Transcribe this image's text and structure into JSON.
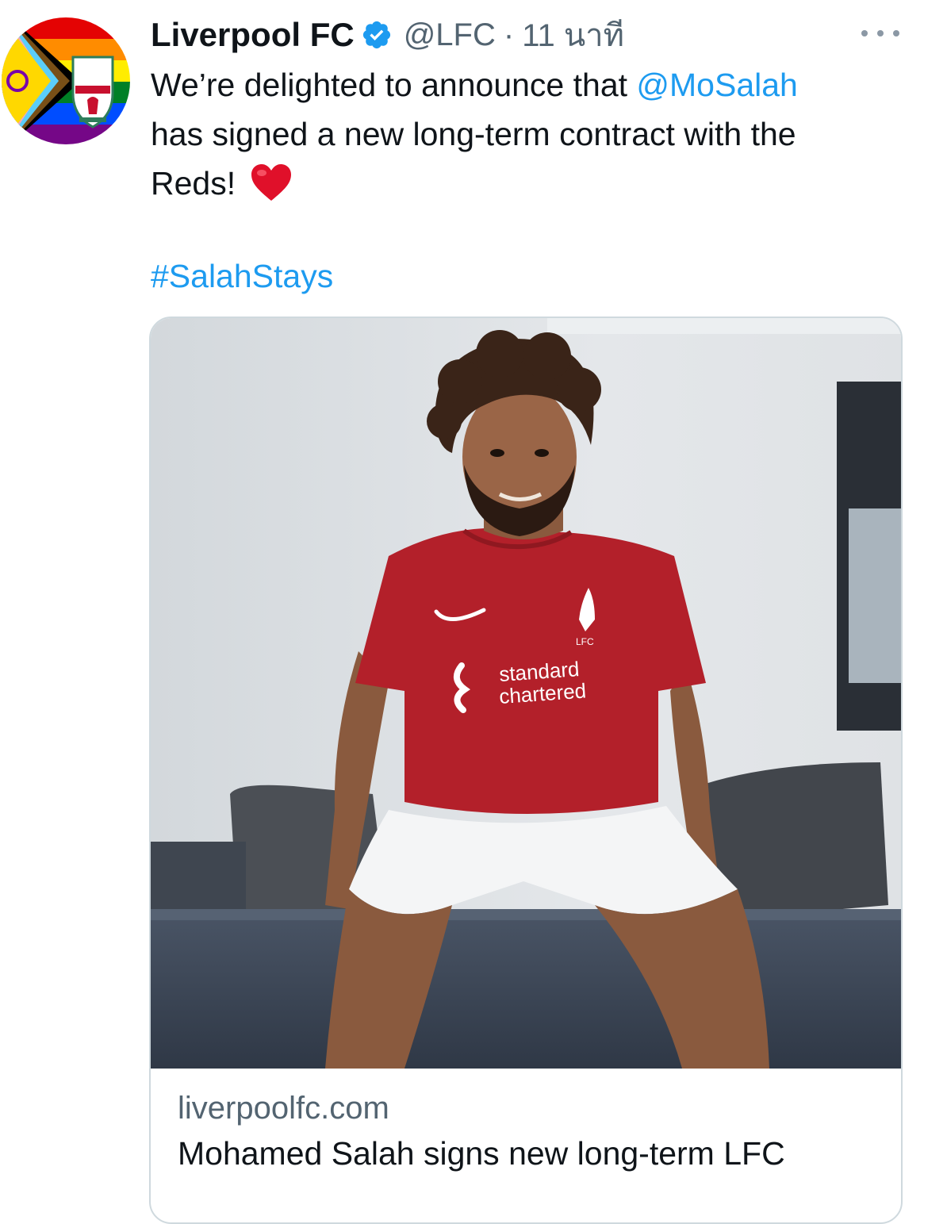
{
  "tweet": {
    "author_name": "Liverpool FC",
    "handle": "@LFC",
    "separator": "·",
    "time": "11 นาที",
    "text_parts": {
      "line1_prefix": "We’re delighted to announce that ",
      "mention": "@MoSalah",
      "line2": "has signed a new long-term contract with the",
      "line3": "Reds!"
    },
    "hashtag": "#SalahStays",
    "more_icon": "more-horizontal-icon",
    "verified_icon": "verified-badge-icon",
    "emoji": "red-heart"
  },
  "link_card": {
    "domain": "liverpoolfc.com",
    "title": "Mohamed Salah signs new long-term LFC"
  },
  "colors": {
    "link": "#1d9bf0",
    "secondary_text": "#536471",
    "primary_text": "#0f1419",
    "card_border": "#cfd9de",
    "jersey_red": "#b3202a"
  }
}
